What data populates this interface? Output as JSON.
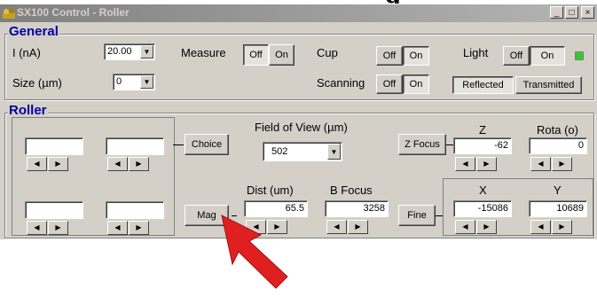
{
  "heading_fragment": "g",
  "window": {
    "title": "SX100 Control - Roller",
    "controls": {
      "minimize": "_",
      "maximize": "□",
      "close": "×"
    }
  },
  "general": {
    "title": "General",
    "current_label": "I (nA)",
    "current_value": "20.00",
    "size_label": "Size (µm)",
    "size_value": "0",
    "measure_label": "Measure",
    "cup_label": "Cup",
    "scanning_label": "Scanning",
    "light_label": "Light",
    "off": "Off",
    "on": "On",
    "reflected": "Reflected",
    "transmitted": "Transmitted"
  },
  "roller": {
    "title": "Roller",
    "choice": "Choice",
    "mag": "Mag",
    "fov_label": "Field of View (µm)",
    "fov_value": "502",
    "dist_label": "Dist (um)",
    "dist_value": "65.5",
    "bfocus_label": "B Focus",
    "bfocus_value": "3258",
    "zfocus": "Z Focus",
    "z_label": "Z",
    "z_value": "-62",
    "rota_label": "Rota (o)",
    "rota_value": "0",
    "fine": "Fine",
    "x_label": "X",
    "x_value": "-15086",
    "y_label": "Y",
    "y_value": "10689"
  },
  "colors": {
    "annotation_arrow": "#e02020",
    "group_label": "#0000a0",
    "light_indicator": "#32c832"
  }
}
